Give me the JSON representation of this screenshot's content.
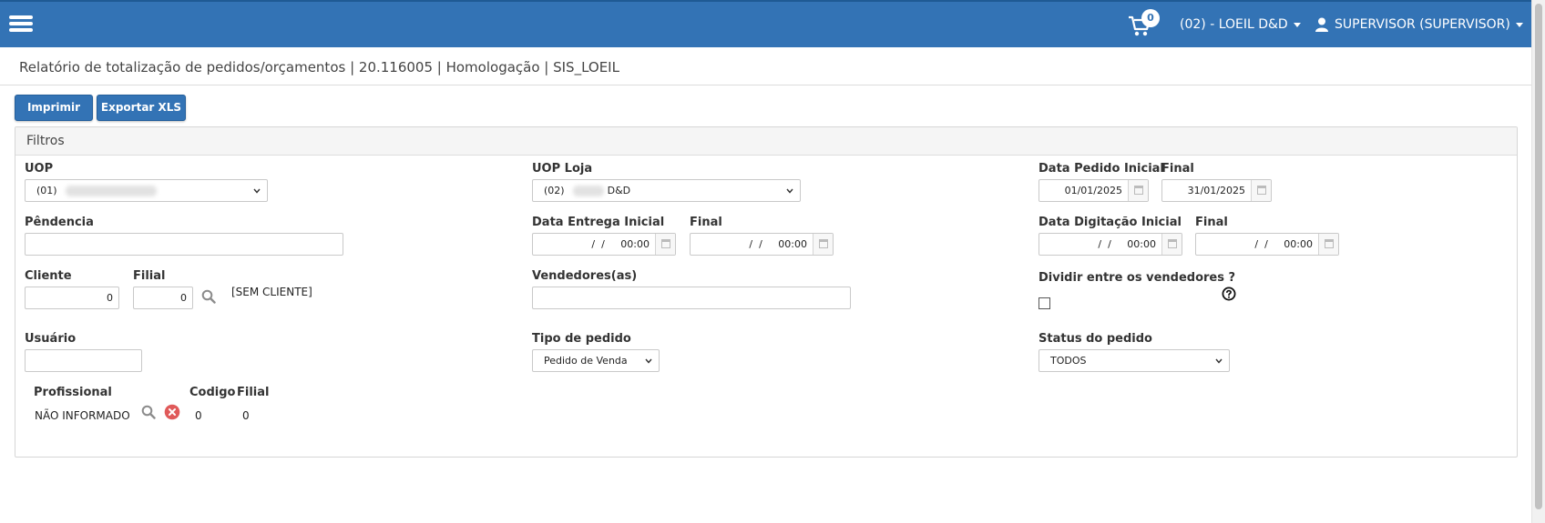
{
  "header": {
    "cart_count": "0",
    "company_menu": "(02) - LOEIL D&D",
    "user_menu": "SUPERVISOR (SUPERVISOR)"
  },
  "page_title": "Relatório de totalização de pedidos/orçamentos | 20.116005 | Homologação | SIS_LOEIL",
  "toolbar": {
    "print_label": "Imprimir",
    "export_label": "Exportar XLS"
  },
  "filters": {
    "title": "Filtros",
    "uop": {
      "label": "UOP",
      "value_prefix": "(01)"
    },
    "uop_loja": {
      "label": "UOP Loja",
      "value_prefix": "(02)",
      "value_suffix": "D&D"
    },
    "data_pedido": {
      "label_inicial": "Data Pedido Inicial",
      "label_final": "Final",
      "inicial": "01/01/2025",
      "final": "31/01/2025"
    },
    "pendencia": {
      "label": "Pêndencia",
      "value": ""
    },
    "data_entrega": {
      "label_inicial": "Data Entrega Inicial",
      "label_final": "Final",
      "inicial": "  /  /     00:00",
      "final": "  /  /     00:00"
    },
    "data_digitacao": {
      "label_inicial": "Data Digitação Inicial",
      "label_final": "Final",
      "inicial": "  /  /     00:00",
      "final": "  /  /     00:00"
    },
    "cliente": {
      "label": "Cliente",
      "value": "0",
      "filial_label": "Filial",
      "filial_value": "0",
      "name": "[SEM CLIENTE]"
    },
    "vendedores": {
      "label": "Vendedores(as)",
      "value": ""
    },
    "dividir": {
      "label": "Dividir entre os vendedores ?"
    },
    "usuario": {
      "label": "Usuário",
      "value": ""
    },
    "tipo_pedido": {
      "label": "Tipo de pedido",
      "value": "Pedido de Venda"
    },
    "status_pedido": {
      "label": "Status do pedido",
      "value": "TODOS"
    },
    "profissional": {
      "header_profissional": "Profissional",
      "header_codigo": "Codigo",
      "header_filial": "Filial",
      "name": "NÃO INFORMADO",
      "codigo": "0",
      "filial": "0"
    }
  },
  "colors": {
    "header_bg": "#3373b5",
    "button_bg": "#3373b5",
    "remove_icon": "#e05a5a"
  }
}
